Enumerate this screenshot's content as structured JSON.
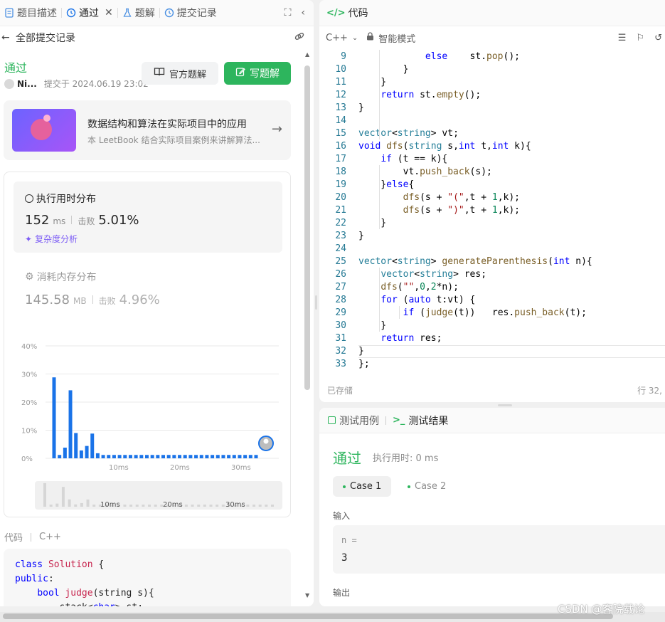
{
  "left_tabs": [
    {
      "label": "题目描述"
    },
    {
      "label": "通过"
    },
    {
      "label": "题解"
    },
    {
      "label": "提交记录"
    }
  ],
  "back": {
    "label": "全部提交记录"
  },
  "submission": {
    "status": "通过",
    "user": "Ni...",
    "submitted_at": "提交于 2024.06.19 23:02",
    "official_solution_btn": "官方题解",
    "write_solution_btn": "写题解"
  },
  "book": {
    "title": "数据结构和算法在实际项目中的应用",
    "subtitle": "本 LeetBook 结合实际项目案例来讲解算法..."
  },
  "runtime": {
    "title": "执行用时分布",
    "value": "152",
    "unit": "ms",
    "beat_label": "击败",
    "beat": "5.01%",
    "complexity": "复杂度分析"
  },
  "memory": {
    "title": "消耗内存分布",
    "value": "145.58",
    "unit": "MB",
    "beat_label": "击败",
    "beat": "4.96%"
  },
  "chart_data": {
    "type": "bar",
    "ylabels": [
      "40%",
      "30%",
      "20%",
      "10%",
      "0%"
    ],
    "ylim": [
      0,
      40
    ],
    "xticks": [
      "10ms",
      "20ms",
      "30ms"
    ],
    "values": [
      28.8,
      1.2,
      3.8,
      24.2,
      9,
      2.8,
      4.4,
      8.8,
      1.8,
      1.2,
      1.2,
      1.2,
      1.2,
      1.2,
      1.2,
      1.2,
      1.2,
      1.2,
      1.2,
      1.2,
      1.2,
      1.2,
      1.2,
      1.2,
      1.2,
      1.2,
      1.2,
      1.2,
      1.2,
      1.2,
      1.2,
      1.2,
      1.2,
      1.2,
      1.2,
      1.2,
      1.2,
      1.2
    ],
    "color": "#1a73e8",
    "grid": true
  },
  "minimap": {
    "xticks": [
      "10ms",
      "20ms",
      "30ms"
    ]
  },
  "code_preview": {
    "label": "代码",
    "lang": "C++",
    "lines": [
      "class Solution {",
      "public:",
      "    bool judge(string s){",
      "        stack<char> st;"
    ]
  },
  "editor": {
    "tab_title": "代码",
    "lang": "C++",
    "mode": "智能模式",
    "saved": "已存储",
    "cursor": "行 32,",
    "lines": [
      {
        "n": "9",
        "t": "            else    st.pop();"
      },
      {
        "n": "10",
        "t": "        }"
      },
      {
        "n": "11",
        "t": "    }"
      },
      {
        "n": "12",
        "t": "    return st.empty();"
      },
      {
        "n": "13",
        "t": "}"
      },
      {
        "n": "14",
        "t": ""
      },
      {
        "n": "15",
        "t": "vector<string> vt;"
      },
      {
        "n": "16",
        "t": "void dfs(string s,int t,int k){"
      },
      {
        "n": "17",
        "t": "    if (t == k){"
      },
      {
        "n": "18",
        "t": "        vt.push_back(s);"
      },
      {
        "n": "19",
        "t": "    }else{"
      },
      {
        "n": "20",
        "t": "        dfs(s + \"(\",t + 1,k);"
      },
      {
        "n": "21",
        "t": "        dfs(s + \")\",t + 1,k);"
      },
      {
        "n": "22",
        "t": "    }"
      },
      {
        "n": "23",
        "t": "}"
      },
      {
        "n": "24",
        "t": ""
      },
      {
        "n": "25",
        "t": "vector<string> generateParenthesis(int n){"
      },
      {
        "n": "26",
        "t": "    vector<string> res;"
      },
      {
        "n": "27",
        "t": "    dfs(\"\",0,2*n);"
      },
      {
        "n": "28",
        "t": "    for (auto t:vt) {"
      },
      {
        "n": "29",
        "t": "        if (judge(t))   res.push_back(t);"
      },
      {
        "n": "30",
        "t": "    }"
      },
      {
        "n": "31",
        "t": "    return res;"
      },
      {
        "n": "32",
        "t": "}"
      },
      {
        "n": "33",
        "t": "};"
      }
    ]
  },
  "test": {
    "tab_cases": "测试用例",
    "tab_result": "测试结果",
    "status": "通过",
    "time": "执行用时: 0 ms",
    "case1": "Case 1",
    "case2": "Case 2",
    "input_label": "输入",
    "input_var": "n =",
    "input_val": "3",
    "output_label": "输出"
  },
  "watermark": "CSDN @客院载论"
}
